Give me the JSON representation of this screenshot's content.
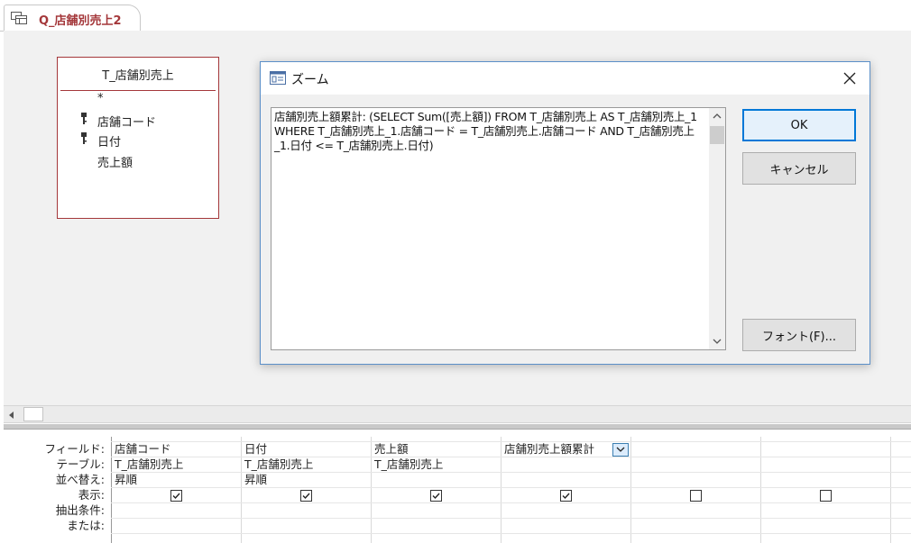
{
  "tab": {
    "title": "Q_店舗別売上2"
  },
  "table_box": {
    "title": "T_店舗別売上",
    "fields": [
      {
        "label": "*",
        "key": false
      },
      {
        "label": "店舗コード",
        "key": true
      },
      {
        "label": "日付",
        "key": true
      },
      {
        "label": "売上額",
        "key": false
      }
    ]
  },
  "dialog": {
    "title": "ズーム",
    "text": "店舗別売上額累計: (SELECT Sum([売上額]) FROM T_店舗別売上 AS T_店舗別売上_1 WHERE T_店舗別売上_1.店舗コード = T_店舗別売上.店舗コード AND T_店舗別売上_1.日付 <= T_店舗別売上.日付)",
    "ok_label": "OK",
    "cancel_label": "キャンセル",
    "font_label": "フォント(F)..."
  },
  "grid": {
    "row_labels": [
      "フィールド:",
      "テーブル:",
      "並べ替え:",
      "表示:",
      "抽出条件:",
      "または:"
    ],
    "columns": [
      {
        "field": "店舗コード",
        "table": "T_店舗別売上",
        "sort": "昇順",
        "show": true
      },
      {
        "field": "日付",
        "table": "T_店舗別売上",
        "sort": "昇順",
        "show": true
      },
      {
        "field": "売上額",
        "table": "T_店舗別売上",
        "sort": "",
        "show": true
      },
      {
        "field": "店舗別売上額累計",
        "table": "",
        "sort": "",
        "show": true
      },
      {
        "field": "",
        "table": "",
        "sort": "",
        "show": false
      },
      {
        "field": "",
        "table": "",
        "sort": "",
        "show": false
      }
    ]
  }
}
